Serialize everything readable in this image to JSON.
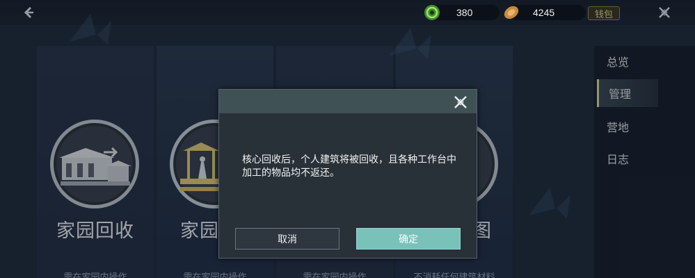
{
  "topbar": {
    "currencies": [
      {
        "icon": "jade-coin-icon",
        "value": "380"
      },
      {
        "icon": "copper-coin-icon",
        "value": "4245"
      }
    ],
    "wallet_label": "钱包"
  },
  "cards": [
    {
      "title": "家园回收",
      "subtitle": "需在家园内操作"
    },
    {
      "title": "家园",
      "subtitle": "需在家园内操作"
    },
    {
      "title": "",
      "subtitle": "需在家园内操作"
    },
    {
      "title": "图",
      "subtitle": "不消耗任何建筑材料"
    }
  ],
  "side_nav": {
    "items": [
      {
        "label": "总览",
        "active": false
      },
      {
        "label": "管理",
        "active": true
      },
      {
        "label": "营地",
        "active": false
      },
      {
        "label": "日志",
        "active": false
      }
    ]
  },
  "dialog": {
    "message": "核心回收后，个人建筑将被回收，且各种工作台中加工的物品均不返还。",
    "cancel_label": "取消",
    "confirm_label": "确定"
  },
  "colors": {
    "background": "#1f2b3d",
    "accent": "#78c2b9",
    "active_marker": "#d9e6a0"
  }
}
